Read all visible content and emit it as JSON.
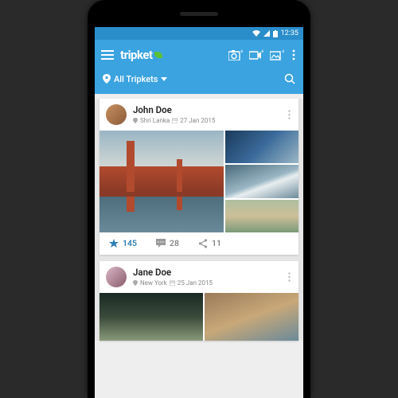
{
  "statusbar": {
    "time": "12:35"
  },
  "appbar": {
    "brand": "tripket",
    "filter_label": "All Tripkets"
  },
  "feed": [
    {
      "author": "John Doe",
      "location": "Shri Lanka",
      "date": "27 Jan 2015",
      "stats": {
        "likes": "145",
        "comments": "28",
        "shares": "11"
      }
    },
    {
      "author": "Jane Doe",
      "location": "New York",
      "date": "25 Jan 2015"
    }
  ]
}
